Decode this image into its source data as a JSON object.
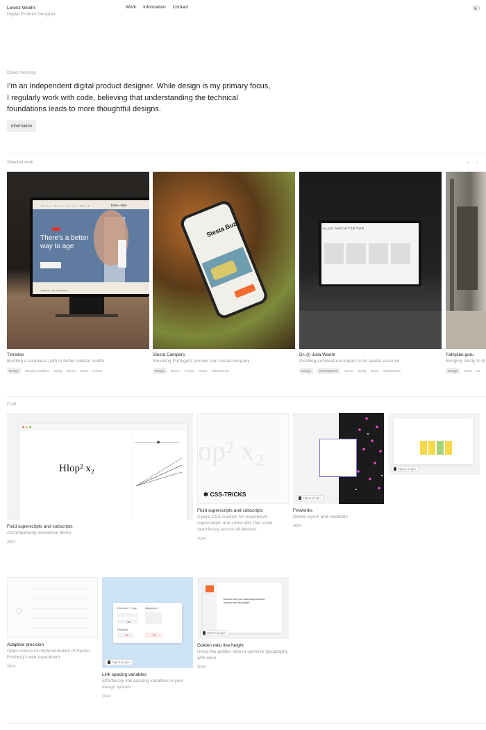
{
  "header": {
    "name": "Lorenz Woehr",
    "role": "Digital Product Designer",
    "nav": [
      "Work",
      "Information",
      "Contact"
    ]
  },
  "hero": {
    "greeting": "Good morning",
    "intro": "I'm an independent digital product designer. While design is my primary focus, I regularly work with code, believing that understanding the technical foundations leads to more thoughtful designs.",
    "button": "Information"
  },
  "selected_work": {
    "label": "Selected work",
    "arrows": [
      "←",
      "→"
    ],
    "items": [
      {
        "title": "Timeline",
        "desc": "Building a seamless path to better cellular health",
        "tags": [
          "Design",
          "Shopify Headless",
          "Sanity",
          "Next.js",
          "React",
          "Framer"
        ],
        "mock": {
          "logo": "time—line",
          "headline": "There's a better way to age",
          "cta": "",
          "footer": "★★★★★ 4.4/5 ★ REVIEWS"
        }
      },
      {
        "title": "Siesta Campers",
        "desc": "Elevating Portugal's premier van rental company",
        "tags": [
          "Design",
          "Next.js",
          "Prismic",
          "React",
          "TailwindCSS"
        ],
        "mock": {
          "logo": "Siesta",
          "headline": "Siesta Buzz"
        }
      },
      {
        "title": "Dr. (I) Julia Woehr",
        "desc": "Distilling architectural impact to its spatial essence",
        "tags": [
          "Design",
          "Development",
          "Next.js",
          "Sanity",
          "React",
          "TailwindCSS"
        ],
        "mock": {
          "logo": "ALLE ARCHITEKTUR"
        }
      },
      {
        "title": "Fahrplan.guru",
        "desc": "Bringing clarity to th",
        "tags": [
          "Design",
          "React",
          "Sa"
        ]
      }
    ]
  },
  "craft": {
    "label": "Craft",
    "items": [
      {
        "title": "Fluid superscripts and subscripts",
        "desc": "Accompanying interactive demo",
        "year": "2024",
        "demo_text": "Hlop² x₂"
      },
      {
        "title": "Fluid superscripts and subscripts",
        "desc": "A pure CSS solution for responsive superscripts and subscripts that scale seamlessly across all devices.",
        "year": "2024",
        "brand": "CSS-TRICKS",
        "ghost": "op² x₂"
      },
      {
        "title": "Fireworks",
        "desc": "Delete layers and celebrate",
        "year": "2024",
        "plugin": "Figma plugin"
      },
      {
        "title": "",
        "desc": "",
        "year": "",
        "plugin": "Figma plugin"
      },
      {
        "title": "Adaptive precision",
        "desc": "Open source re-implementation of Rauno Freiberg's web experiment",
        "year": "2024"
      },
      {
        "title": "Link spacing variables",
        "desc": "Effortlessly link spacing variables to your design system",
        "year": "2024",
        "plugin": "Figma plugin",
        "panel": {
          "dir": "Direction + Gap",
          "align": "Alignment",
          "padding": "Padding",
          "gap_val": "48",
          "pad_a": "16",
          "pad_b": "32"
        }
      },
      {
        "title": "Golden ratio line height",
        "desc": "Using the golden ratio to optimize typography with ease",
        "year": "2015",
        "plugin": "Sketch plugin",
        "doc_title": "Discover the true relationship between font size and line height"
      }
    ]
  },
  "colors": {
    "accent_pink": "#e24fd6",
    "red_badge": "#d93a3a",
    "orange_cta": "#f26a2e"
  }
}
